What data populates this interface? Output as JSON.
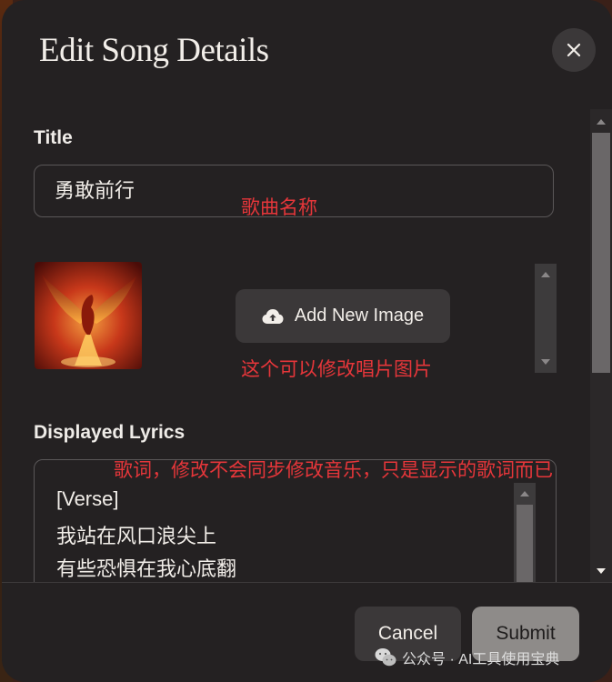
{
  "dialog": {
    "title": "Edit Song Details",
    "close_icon": "close-icon"
  },
  "form": {
    "title_label": "Title",
    "title_value": "勇敢前行",
    "add_image_label": "Add New Image",
    "upload_icon": "cloud-upload-icon",
    "lyrics_label": "Displayed Lyrics",
    "lyrics_lines": [
      "[Verse]",
      "我站在风口浪尖上",
      "有些恐惧在我心底翻"
    ]
  },
  "annotations": {
    "title_note": "歌曲名称",
    "image_note": "这个可以修改唱片图片",
    "lyrics_note": "歌词，修改不会同步修改音乐，只是显示的歌词而已"
  },
  "footer": {
    "cancel_label": "Cancel",
    "submit_label": "Submit"
  },
  "watermark": {
    "text": "公众号 · AI工具使用宝典",
    "icon": "wechat-icon"
  },
  "colors": {
    "dialog_bg": "#242122",
    "button_bg": "#3b3839",
    "submit_bg": "#8e8b89",
    "annotation_red": "#e6363a",
    "text": "#f2eee9"
  }
}
